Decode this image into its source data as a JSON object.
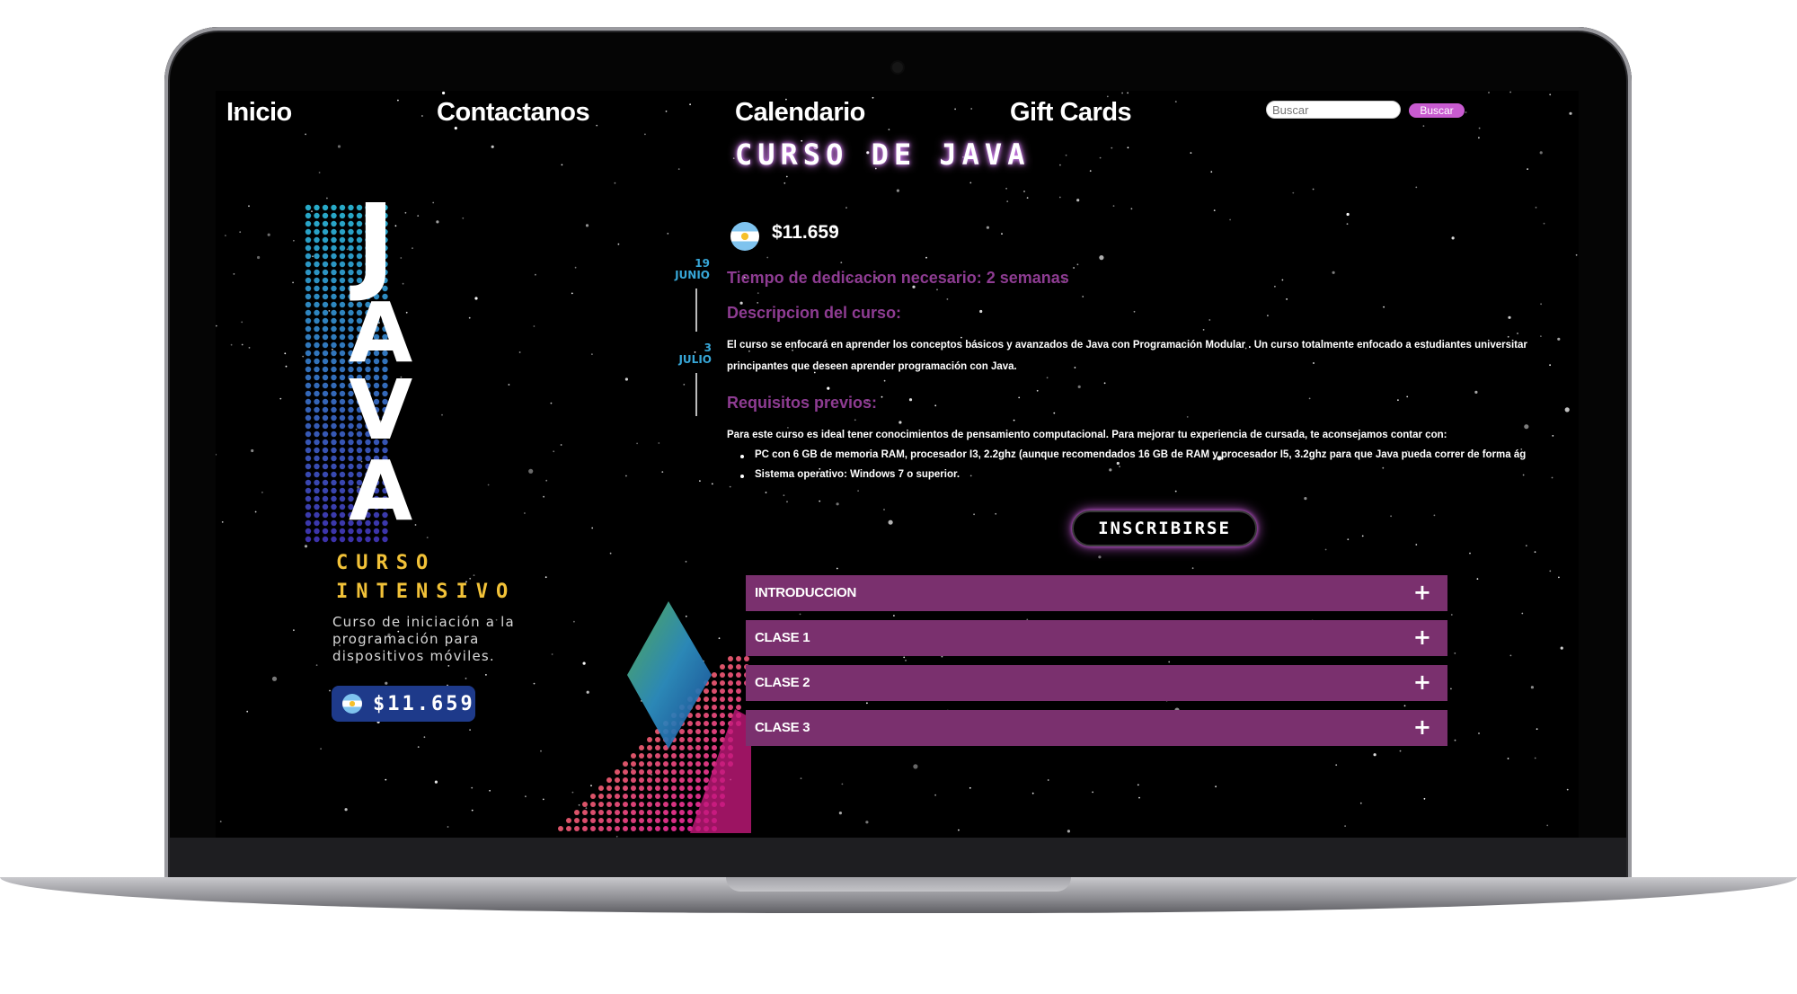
{
  "nav": {
    "links": [
      "Inicio",
      "Contactanos",
      "Calendario",
      "Gift Cards"
    ],
    "search_placeholder": "Buscar",
    "search_button": "Buscar"
  },
  "poster": {
    "letters": [
      "J",
      "A",
      "V",
      "A"
    ],
    "date1": [
      "19",
      "JUNIO"
    ],
    "date2": [
      "3",
      "JULIO"
    ],
    "curso_title": [
      "CURSO",
      "INTENSIVO"
    ],
    "description": [
      "Curso de iniciación a la",
      "programación para",
      "dispositivos móviles."
    ],
    "price": "$11.659",
    "flag_icon": "argentina-flag-icon"
  },
  "course": {
    "title": "CURSO DE JAVA",
    "price": "$11.659",
    "dedication": "Tiempo de dedicacion necesario: 2 semanas",
    "description_title": "Descripcion del curso:",
    "description_lines": [
      "El curso se enfocará en aprender los conceptos básicos y avanzados de Java con Programación Modular . Un curso totalmente enfocado a estudiantes universitar",
      "principantes que deseen aprender programación con Java."
    ],
    "requirements_title": "Requisitos previos:",
    "requirements_intro": "Para este curso es ideal tener conocimientos de pensamiento computacional. Para mejorar tu experiencia de cursada, te aconsejamos contar con:",
    "requirements": [
      "PC con 6 GB de memoria RAM, procesador I3, 2.2ghz (aunque recomendados 16 GB de RAM y procesador I5, 3.2ghz para que Java pueda correr de forma ág",
      "Sistema operativo: Windows 7 o superior."
    ],
    "enroll_button": "INSCRIBIRSE",
    "accordion": [
      "INTRODUCCION",
      "CLASE 1",
      "CLASE 2",
      "CLASE 3"
    ],
    "accordion_icon": "plus-icon"
  },
  "colors": {
    "accent_purple": "#7a306e",
    "heading_purple": "#8e3c92",
    "poster_gold": "#f2c238",
    "date_blue": "#37a7d8"
  }
}
